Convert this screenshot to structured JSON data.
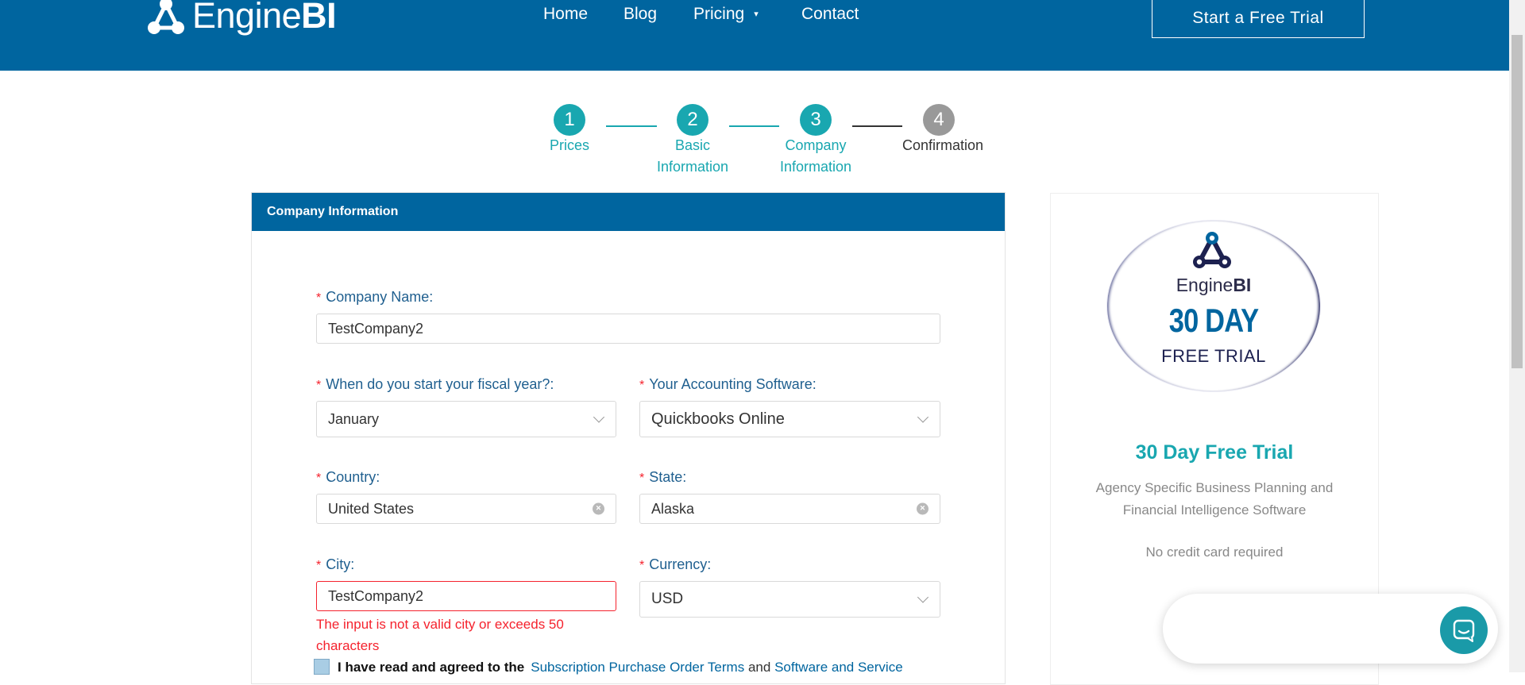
{
  "header": {
    "logo_light": "Engine",
    "logo_bold": "BI",
    "nav": [
      {
        "label": "Home"
      },
      {
        "label": "Blog"
      },
      {
        "label": "Pricing"
      },
      {
        "label": "Contact"
      }
    ],
    "pricing_caret": "▾",
    "cta": "Start a Free Trial"
  },
  "steps": [
    {
      "number": "1",
      "label_line1": "Prices",
      "label_line2": "",
      "status": "done"
    },
    {
      "number": "2",
      "label_line1": "Basic",
      "label_line2": "Information",
      "status": "done"
    },
    {
      "number": "3",
      "label_line1": "Company",
      "label_line2": "Information",
      "status": "done"
    },
    {
      "number": "4",
      "label_line1": "Confirmation",
      "label_line2": "",
      "status": "todo"
    }
  ],
  "form": {
    "title": "Company Information",
    "required_mark": "*",
    "company_name": {
      "label": "Company Name:",
      "value": "TestCompany2"
    },
    "fiscal_year": {
      "label": "When do you start your fiscal year?:",
      "value": "January"
    },
    "accounting_software": {
      "label": "Your Accounting Software:",
      "value": "Quickbooks Online"
    },
    "country": {
      "label": "Country:",
      "value": "United States"
    },
    "state": {
      "label": "State:",
      "value": "Alaska"
    },
    "city": {
      "label": "City:",
      "value": "TestCompany2",
      "error": "The input is not a valid city or exceeds 50 characters"
    },
    "currency": {
      "label": "Currency:",
      "value": "USD"
    },
    "agreement": {
      "prefix": "I have read and agreed to the",
      "link1": "Subscription Purchase Order Terms",
      "joiner": "and",
      "link2": "Software and Service"
    }
  },
  "trial_card": {
    "badge_brand_light": "Engine",
    "badge_brand_bold": "BI",
    "badge_big": "30 DAY",
    "badge_small": "FREE TRIAL",
    "title": "30 Day Free Trial",
    "description": "Agency Specific Business Planning and Financial Intelligence Software",
    "note": "No credit card required"
  },
  "colors": {
    "brand_blue": "#00659f",
    "teal": "#19a7b0",
    "error_red": "#f5222d",
    "inactive_gray": "#999999"
  },
  "icons": [
    "enginebi-logo-icon",
    "chevron-down-icon",
    "clear-icon",
    "chat-icon"
  ]
}
